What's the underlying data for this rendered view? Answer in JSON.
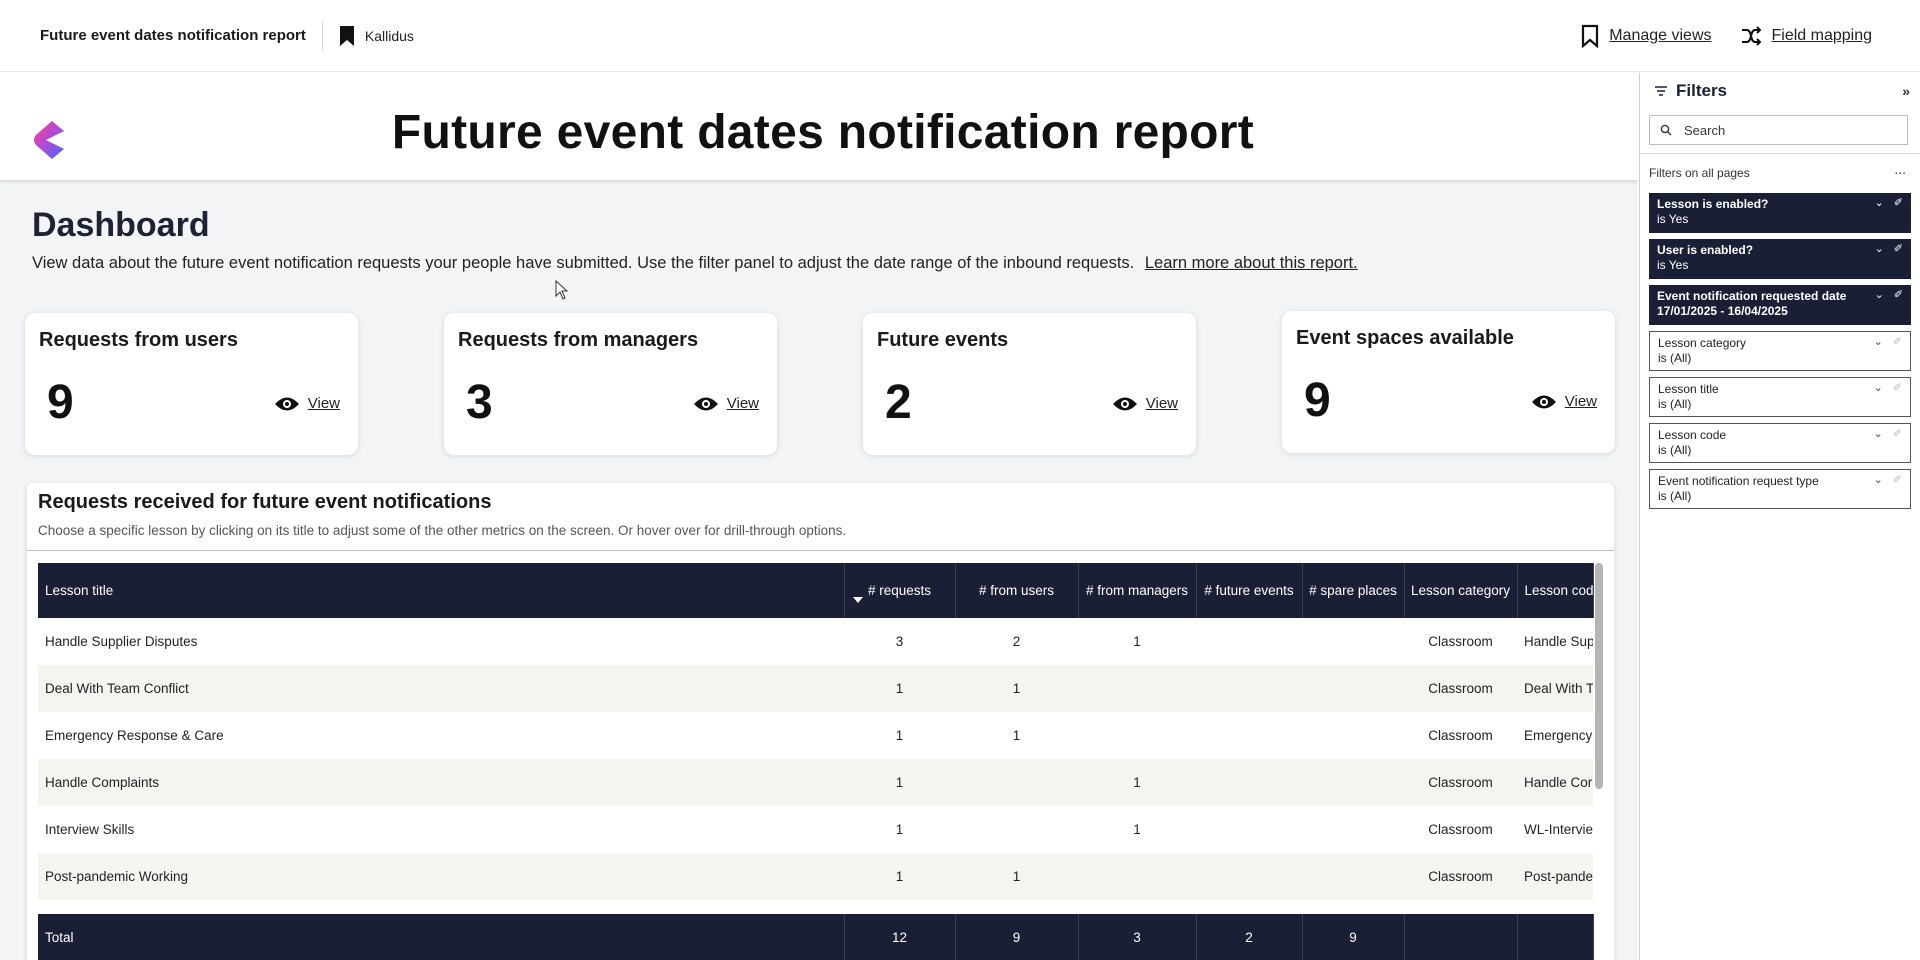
{
  "topbar": {
    "report_name": "Future event dates notification report",
    "workspace": "Kallidus",
    "manage_views": "Manage views",
    "field_mapping": "Field mapping"
  },
  "banner": {
    "title": "Future event dates notification report"
  },
  "dashboard": {
    "title": "Dashboard",
    "description": "View data about the future event notification requests your people have submitted. Use the filter panel to adjust the date range of the inbound requests.",
    "learn_more": "Learn more about this report."
  },
  "cards": [
    {
      "title": "Requests from users",
      "value": "9",
      "view": "View"
    },
    {
      "title": "Requests from managers",
      "value": "3",
      "view": "View"
    },
    {
      "title": "Future events",
      "value": "2",
      "view": "View"
    },
    {
      "title": "Event spaces available",
      "value": "9",
      "view": "View"
    }
  ],
  "table": {
    "title": "Requests received for future event notifications",
    "subtitle": "Choose a specific lesson by clicking on its title to adjust some of the other metrics on the screen. Or hover over for drill-through options.",
    "columns": [
      "Lesson title",
      "# requests",
      "# from users",
      "# from managers",
      "# future events",
      "# spare places",
      "Lesson category",
      "Lesson cod"
    ],
    "rows": [
      [
        "Handle Supplier Disputes",
        "3",
        "2",
        "1",
        "",
        "",
        "Classroom",
        "Handle Supp"
      ],
      [
        "Deal With Team Conflict",
        "1",
        "1",
        "",
        "",
        "",
        "Classroom",
        "Deal With T"
      ],
      [
        "Emergency Response & Care",
        "1",
        "1",
        "",
        "",
        "",
        "Classroom",
        "Emergency"
      ],
      [
        "Handle Complaints",
        "1",
        "",
        "1",
        "",
        "",
        "Classroom",
        "Handle Cor"
      ],
      [
        "Interview Skills",
        "1",
        "",
        "1",
        "",
        "",
        "Classroom",
        "WL-Intervie"
      ],
      [
        "Post-pandemic Working",
        "1",
        "1",
        "",
        "",
        "",
        "Classroom",
        "Post-pande"
      ]
    ],
    "total": [
      "Total",
      "12",
      "9",
      "3",
      "2",
      "9",
      "",
      ""
    ]
  },
  "filters": {
    "title": "Filters",
    "search_placeholder": "Search",
    "all_pages": "Filters on all pages",
    "more": "...",
    "items": [
      {
        "name": "Lesson is enabled?",
        "value": "is Yes",
        "active": true
      },
      {
        "name": "User is enabled?",
        "value": "is Yes",
        "active": true
      },
      {
        "name": "Event notification requested date",
        "value": "17/01/2025 - 16/04/2025",
        "active": true
      },
      {
        "name": "Lesson category",
        "value": "is (All)",
        "active": false
      },
      {
        "name": "Lesson title",
        "value": "is (All)",
        "active": false
      },
      {
        "name": "Lesson code",
        "value": "is (All)",
        "active": false
      },
      {
        "name": "Event notification request type",
        "value": "is (All)",
        "active": false
      }
    ]
  }
}
